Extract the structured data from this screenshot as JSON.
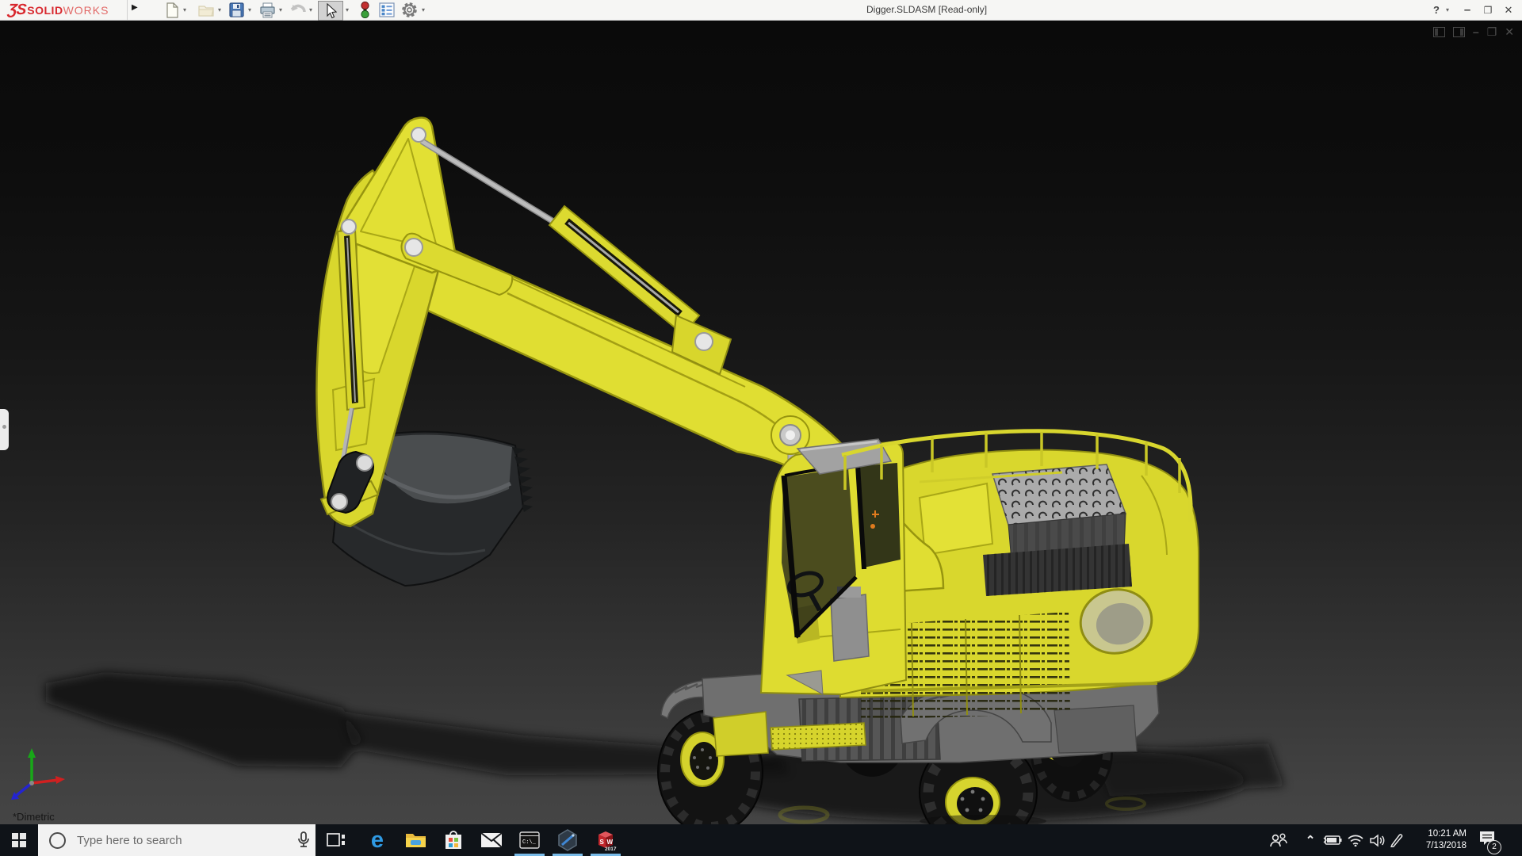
{
  "window": {
    "title": "Digger.SLDASM [Read-only]"
  },
  "brand": {
    "glyph": "ƷS",
    "bold": "SOLID",
    "light": "WORKS"
  },
  "icons": {
    "flyout_arrow": "▶",
    "dropdown_caret": "▾",
    "help": "?",
    "minimize": "–",
    "restore": "❐",
    "close": "✕",
    "chevron_up": "⌃",
    "edge_e": "e",
    "cmd_prompt": "C:\\_"
  },
  "viewport": {
    "view_orientation_label": "*Dimetric"
  },
  "taskbar": {
    "search_placeholder": "Type here to search"
  },
  "sw_app": {
    "s": "S",
    "w": "W",
    "year": "2017"
  },
  "tray": {
    "time": "10:21 AM",
    "date": "7/13/2018",
    "notification_badge": "2"
  },
  "colors": {
    "solidworks_red": "#d8282e",
    "machine_yellow": "#dedc30",
    "taskbar_bg": "#0f1318",
    "search_box_bg": "#f2f2f2",
    "running_accent": "#79bbe8"
  }
}
